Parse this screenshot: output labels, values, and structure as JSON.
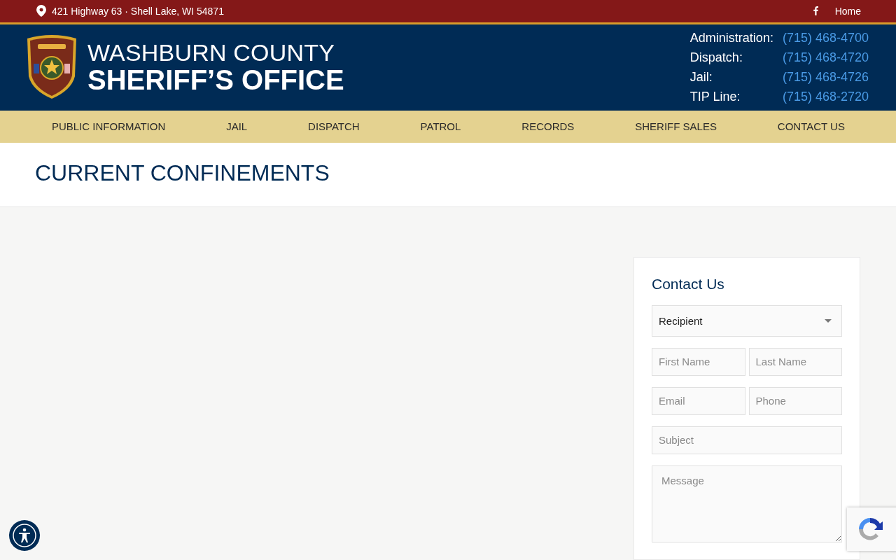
{
  "top_bar": {
    "address": "421 Highway 63 · Shell Lake, WI 54871",
    "links": [
      "Home"
    ]
  },
  "header": {
    "title_line_1": "WASHBURN COUNTY",
    "title_line_2": "SHERIFF’S OFFICE",
    "contacts": [
      {
        "label": "Administration:",
        "phone": "(715) 468-4700"
      },
      {
        "label": "Dispatch:",
        "phone": "(715) 468-4720"
      },
      {
        "label": "Jail:",
        "phone": "(715) 468-4726"
      },
      {
        "label": "TIP Line:",
        "phone": "(715) 468-2720"
      }
    ]
  },
  "nav": [
    "PUBLIC INFORMATION",
    "JAIL",
    "DISPATCH",
    "PATROL",
    "RECORDS",
    "SHERIFF SALES",
    "CONTACT US"
  ],
  "page_title": "CURRENT CONFINEMENTS",
  "contact_form": {
    "title": "Contact Us",
    "recipient": "Recipient",
    "rows": [
      [
        {
          "placeholder": "First Name"
        },
        {
          "placeholder": "Last Name"
        }
      ],
      [
        {
          "placeholder": "Email"
        },
        {
          "placeholder": "Phone"
        }
      ],
      [
        {
          "placeholder": "Subject"
        }
      ]
    ],
    "message": {
      "placeholder": "Message"
    }
  }
}
